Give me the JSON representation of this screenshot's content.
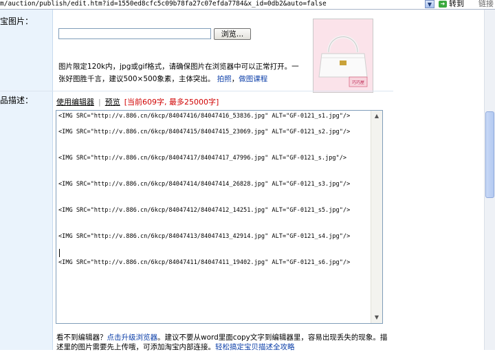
{
  "address_bar": {
    "url": "m/auction/publish/edit.htm?id=1550ed8cfc5c09b78fa27c07efda7784&x_id=0db2&auto=false",
    "go_label": "转到",
    "links_label": "链接"
  },
  "image_row": {
    "label": "宝图片：",
    "browse_label": "浏览...",
    "note_text": "图片限定120k内，jpg或gif格式，请确保图片在浏览器中可以正常打开。一张好图胜千言，建议500×500象素，主体突出。",
    "link_photo": "拍照",
    "link_sep": "，",
    "link_tutorial": "做图课程",
    "thumb_tag": "巧巧屋"
  },
  "desc_row": {
    "label": "品描述：",
    "use_editor": "使用编辑器",
    "separator": "|",
    "preview": "预览",
    "char_count": "[当前609字, 最多25000字]",
    "lines": [
      "<IMG SRC=\"http://v.886.cn/6kcp/84047416/84047416_53836.jpg\" ALT=\"GF-0121_s1.jpg\"/>",
      "<IMG SRC=\"http://v.886.cn/6kcp/84047415/84047415_23069.jpg\" ALT=\"GF-0121_s2.jpg\"/>",
      "<IMG SRC=\"http://v.886.cn/6kcp/84047417/84047417_47996.jpg\" ALT=\"GF-0121_s.jpg\"/>",
      "<IMG SRC=\"http://v.886.cn/6kcp/84047414/84047414_26828.jpg\" ALT=\"GF-0121_s3.jpg\"/>",
      "<IMG SRC=\"http://v.886.cn/6kcp/84047412/84047412_14251.jpg\" ALT=\"GF-0121_s5.jpg\"/>",
      "<IMG SRC=\"http://v.886.cn/6kcp/84047413/84047413_42914.jpg\" ALT=\"GF-0121_s4.jpg\"/>",
      "<IMG SRC=\"http://v.886.cn/6kcp/84047411/84047411_19402.jpg\" ALT=\"GF-0121_s6.jpg\"/>"
    ],
    "bottom_note_1": "看不到编辑器？",
    "bottom_link_1": "点击升级浏览器",
    "bottom_note_2": "。建议不要从word里面copy文字到编辑器里，容易出现丢失的现象。描述里的图片需要先上传哦，可添加淘宝内部连接。",
    "bottom_link_2": "轻松搞定宝贝描述全攻略"
  },
  "icons": {
    "dropdown": "chevron-down-icon",
    "go": "go-arrow-icon",
    "scroll_up": "arrow-up-icon",
    "scroll_down": "arrow-down-icon"
  },
  "colors": {
    "left_column": "#eaf3fc",
    "link": "#0b3ea8",
    "warning": "#d00000"
  }
}
